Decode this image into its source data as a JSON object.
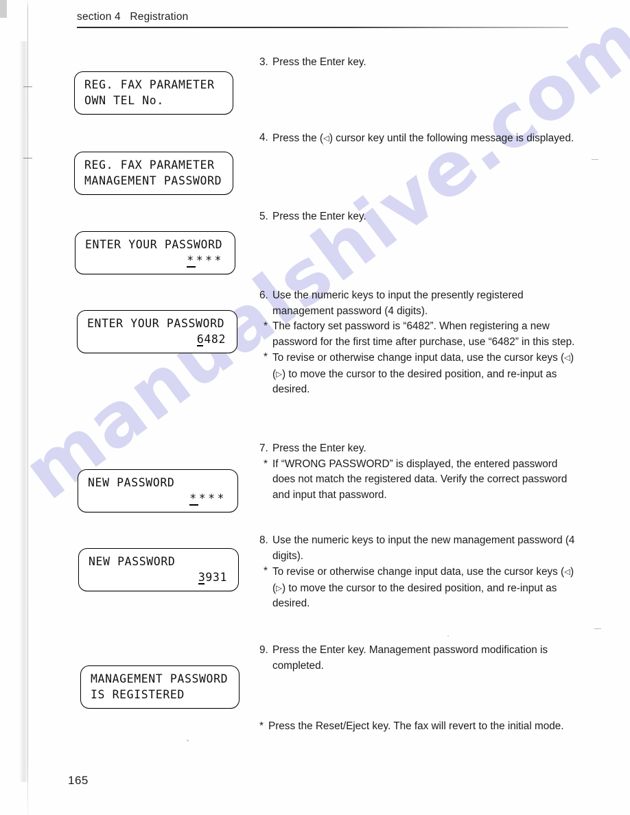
{
  "document": {
    "header": "section 4   Registration",
    "page_number": "165",
    "watermark": "manualshive.com"
  },
  "lcd_panels": [
    {
      "id": "reg-fax-parameter-own-tel",
      "line1": "REG. FAX PARAMETER",
      "line2": "OWN TEL No."
    },
    {
      "id": "reg-fax-parameter-management-password",
      "line1": "REG. FAX PARAMETER",
      "line2": "MANAGEMENT PASSWORD"
    },
    {
      "id": "enter-your-password-masked",
      "line1": "ENTER YOUR PASSWORD",
      "cursor_char": "*",
      "rest": "***"
    },
    {
      "id": "enter-your-password-6482",
      "line1": "ENTER YOUR PASSWORD",
      "cursor_char": "6",
      "rest": "482"
    },
    {
      "id": "new-password-masked",
      "line1": "NEW PASSWORD",
      "cursor_char": "*",
      "rest": "***"
    },
    {
      "id": "new-password-3931",
      "line1": "NEW PASSWORD",
      "cursor_char": "3",
      "rest": "931"
    },
    {
      "id": "management-password-is-registered",
      "line1": "MANAGEMENT PASSWORD",
      "line2": "IS REGISTERED"
    }
  ],
  "steps": {
    "step3": {
      "number": "3.",
      "text": "Press the Enter key."
    },
    "step4": {
      "number": "4.",
      "text_before": "Press the (",
      "key_glyph": "◁",
      "text_after": ") cursor key until the following message is displayed."
    },
    "step5": {
      "number": "5.",
      "text": "Press the Enter key."
    },
    "step6": {
      "number": "6.",
      "text": "Use the numeric keys to input the presently registered management password (4 digits).",
      "note1_star": "*",
      "note1": "The factory set password is “6482”. When registering a new password for the first time after purchase, use “6482” in this step.",
      "note2_star": "*",
      "note2_before": "To revise or otherwise change input data, use the cursor keys (",
      "note2_key_left": "◁",
      "note2_mid": ") (",
      "note2_key_right": "▷",
      "note2_after": ") to move the cursor to the desired position, and re-input as desired."
    },
    "step7": {
      "number": "7.",
      "text": "Press the Enter key.",
      "note_star": "*",
      "note": "If “WRONG PASSWORD” is displayed, the entered password does not match the registered data. Verify the correct password and input that password."
    },
    "step8": {
      "number": "8.",
      "text": "Use the numeric keys to input the new management password (4 digits).",
      "note_star": "*",
      "note_before": "To revise or otherwise change input data, use the cursor keys (",
      "note_key_left": "◁",
      "note_mid": ") (",
      "note_key_right": "▷",
      "note_after": ") to move the cursor to the desired position, and re-input as desired."
    },
    "step9": {
      "number": "9.",
      "text": "Press the Enter key. Management password modification is completed."
    },
    "final_note": {
      "star": "*",
      "text": "Press the Reset/Eject key. The fax will revert to the initial mode."
    }
  }
}
